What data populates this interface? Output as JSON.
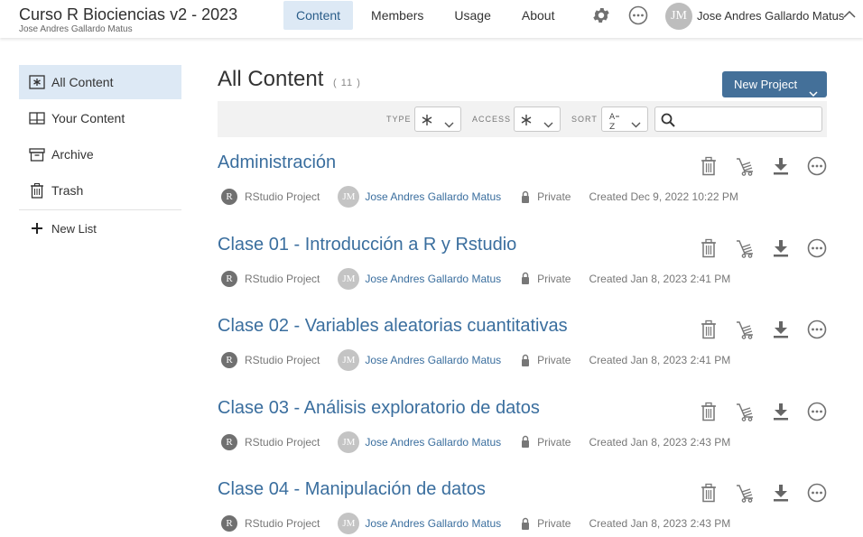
{
  "header": {
    "space_title": "Curso R Biociencias v2 - 2023",
    "space_owner": "Jose Andres Gallardo Matus",
    "nav": [
      {
        "label": "Content",
        "active": true
      },
      {
        "label": "Members",
        "active": false
      },
      {
        "label": "Usage",
        "active": false
      },
      {
        "label": "About",
        "active": false
      }
    ],
    "icons": [
      "gear-icon",
      "more-icon",
      "caret-up-icon"
    ],
    "user_initials": "JM",
    "user_name": "Jose Andres Gallardo Matus"
  },
  "sidebar": {
    "items": [
      {
        "label": "All Content",
        "icon": "asterisk-box-icon",
        "active": true
      },
      {
        "label": "Your Content",
        "icon": "book-icon",
        "active": false
      },
      {
        "label": "Archive",
        "icon": "archive-icon",
        "active": false
      },
      {
        "label": "Trash",
        "icon": "trash-icon",
        "active": false
      }
    ],
    "new_list": "New List"
  },
  "main": {
    "title": "All Content",
    "count": "( 11 )",
    "new_project": "New Project",
    "filters": {
      "type_label": "TYPE",
      "access_label": "ACCESS",
      "sort_label": "SORT",
      "search_placeholder": ""
    },
    "rows": [
      {
        "title": "Administración",
        "type": "RStudio Project",
        "owner_initials": "JM",
        "owner": "Jose Andres Gallardo Matus",
        "access": "Private",
        "created": "Created Dec 9, 2022 10:22 PM"
      },
      {
        "title": "Clase 01 - Introducción a R y Rstudio",
        "type": "RStudio Project",
        "owner_initials": "JM",
        "owner": "Jose Andres Gallardo Matus",
        "access": "Private",
        "created": "Created Jan 8, 2023 2:41 PM"
      },
      {
        "title": "Clase 02 - Variables aleatorias cuantitativas",
        "type": "RStudio Project",
        "owner_initials": "JM",
        "owner": "Jose Andres Gallardo Matus",
        "access": "Private",
        "created": "Created Jan 8, 2023 2:41 PM"
      },
      {
        "title": "Clase 03 - Análisis exploratorio de datos",
        "type": "RStudio Project",
        "owner_initials": "JM",
        "owner": "Jose Andres Gallardo Matus",
        "access": "Private",
        "created": "Created Jan 8, 2023 2:43 PM"
      },
      {
        "title": "Clase 04 - Manipulación de datos",
        "type": "RStudio Project",
        "owner_initials": "JM",
        "owner": "Jose Andres Gallardo Matus",
        "access": "Private",
        "created": "Created Jan 8, 2023 2:43 PM"
      }
    ]
  },
  "colors": {
    "accent": "#447099",
    "link": "#3a6e9e",
    "active_bg": "#dde9f5"
  }
}
